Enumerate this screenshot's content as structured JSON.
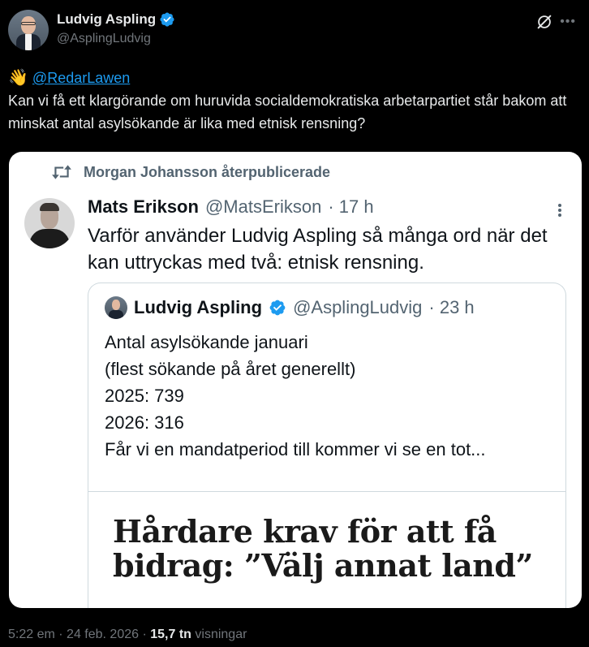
{
  "author": {
    "display_name": "Ludvig Aspling",
    "handle": "@AsplingLudvig"
  },
  "post": {
    "emoji": "👋",
    "mention": "@RedarLawen",
    "text": "Kan vi få ett klargörande om huruvida socialdemokratiska arbetarpartiet står bakom att minskat antal asylsökande är lika med etnisk rensning?"
  },
  "embedded": {
    "repost_label": "Morgan Johansson återpublicerade",
    "name": "Mats Erikson",
    "handle": "@MatsErikson",
    "time": "· 17 h",
    "text": "Varför använder Ludvig Aspling så många ord när det kan uttryckas med två: etnisk rensning.",
    "quoted": {
      "name": "Ludvig Aspling",
      "handle": "@AsplingLudvig",
      "time": "· 23 h",
      "lines": [
        "Antal asylsökande januari",
        "(flest sökande på året generellt)",
        "2025: 739",
        "2026: 316",
        "Får vi en mandatperiod till kommer vi se en tot..."
      ],
      "headline_lines": [
        "Hårdare krav för att få",
        "bidrag: ”Välj annat land”"
      ]
    }
  },
  "footer": {
    "time": "5:22 em",
    "sep1": "·",
    "date": "24 feb. 2026",
    "sep2": "·",
    "views_count": "15,7 tn",
    "views_label": "visningar"
  },
  "colors": {
    "accent": "#1d9bf0",
    "background": "#000000",
    "muted": "#71767b"
  }
}
